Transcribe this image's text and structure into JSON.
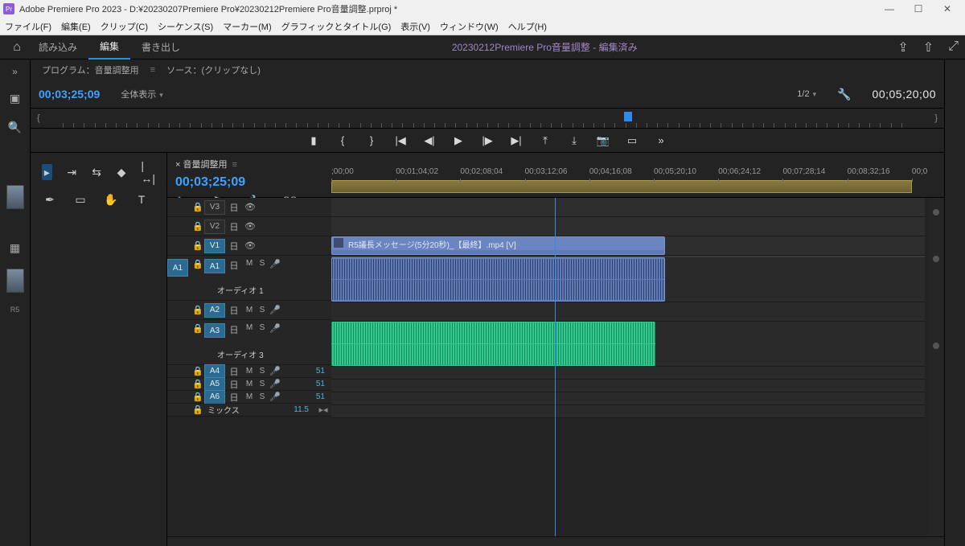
{
  "titlebar": {
    "icon": "Pr",
    "title": "Adobe Premiere Pro 2023 - D:¥20230207Premiere Pro¥20230212Premiere Pro音量調整.prproj *"
  },
  "menubar": {
    "file": "ファイル(F)",
    "edit": "編集(E)",
    "clip": "クリップ(C)",
    "sequence": "シーケンス(S)",
    "marker": "マーカー(M)",
    "graphic": "グラフィックとタイトル(G)",
    "view": "表示(V)",
    "window": "ウィンドウ(W)",
    "help": "ヘルプ(H)"
  },
  "workspace": {
    "tabs": {
      "learn": "読み込み",
      "edit": "編集",
      "export": "書き出し"
    },
    "center": "20230212Premiere Pro音量調整 - 編集済み"
  },
  "program": {
    "panel_tab_1": "プログラム：音量調整用",
    "panel_tab_2": "ソース：(クリップなし)",
    "timecode": "00;03;25;09",
    "display_mode": "全体表示",
    "scale": "1/2",
    "duration": "00;05;20;00"
  },
  "timeline": {
    "title": "音量調整用",
    "timecode": "00;03;25;09",
    "ruler": {
      "labels": [
        ";00;00",
        "00;01;04;02",
        "00;02;08;04",
        "00;03;12;06",
        "00;04;16;08",
        "00;05;20;10",
        "00;06;24;12",
        "00;07;28;14",
        "00;08;32;16",
        "00;0"
      ]
    },
    "playhead_pct": 36.5,
    "tracks": {
      "v3": "V3",
      "v2": "V2",
      "v1": "V1",
      "a1": "A1",
      "a2": "A2",
      "a3": "A3",
      "a4": "A4",
      "a5": "A5",
      "a6": "A6",
      "audio1_label": "オーディオ 1",
      "audio3_label": "オーディオ 3",
      "mix": "ミックス",
      "mix_val": "11.5",
      "m": "M",
      "s": "S",
      "short_val": "51"
    },
    "clip_v1": "R5議長メッセージ(5分20秒)_【最終】.mp4 [V]",
    "clip_start_pct": 0,
    "clip_end_pct": 56.2,
    "clip_green_end_pct": 54.6
  }
}
